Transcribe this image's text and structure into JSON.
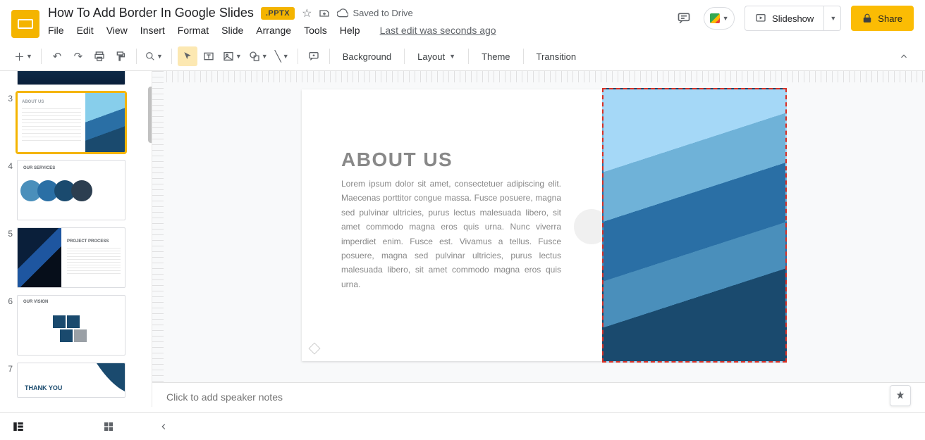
{
  "doc": {
    "title": "How To Add Border In Google Slides",
    "badge": ".PPTX",
    "saved": "Saved to Drive",
    "last_edit": "Last edit was seconds ago"
  },
  "menus": [
    "File",
    "Edit",
    "View",
    "Insert",
    "Format",
    "Slide",
    "Arrange",
    "Tools",
    "Help"
  ],
  "actions": {
    "slideshow": "Slideshow",
    "share": "Share"
  },
  "toolbar": {
    "background": "Background",
    "layout": "Layout",
    "theme": "Theme",
    "transition": "Transition"
  },
  "filmstrip": [
    {
      "n": "3",
      "kind": "about",
      "title": "ABOUT US"
    },
    {
      "n": "4",
      "kind": "services",
      "title": "OUR SERVICES"
    },
    {
      "n": "5",
      "kind": "process",
      "title": "PROJECT PROCESS"
    },
    {
      "n": "6",
      "kind": "vision",
      "title": "OUR VISION"
    },
    {
      "n": "7",
      "kind": "thanks",
      "title": "THANK YOU"
    }
  ],
  "slide": {
    "title": "ABOUT US",
    "body": "Lorem ipsum dolor sit amet, consectetuer adipiscing elit. Maecenas porttitor congue massa. Fusce posuere, magna sed pulvinar ultricies, purus lectus malesuada libero, sit amet commodo magna eros quis urna. Nunc viverra imperdiet enim. Fusce est. Vivamus a tellus. Fusce posuere, magna sed pulvinar ultricies, purus lectus malesuada libero, sit amet commodo magna eros quis urna."
  },
  "notes_placeholder": "Click to add speaker notes"
}
